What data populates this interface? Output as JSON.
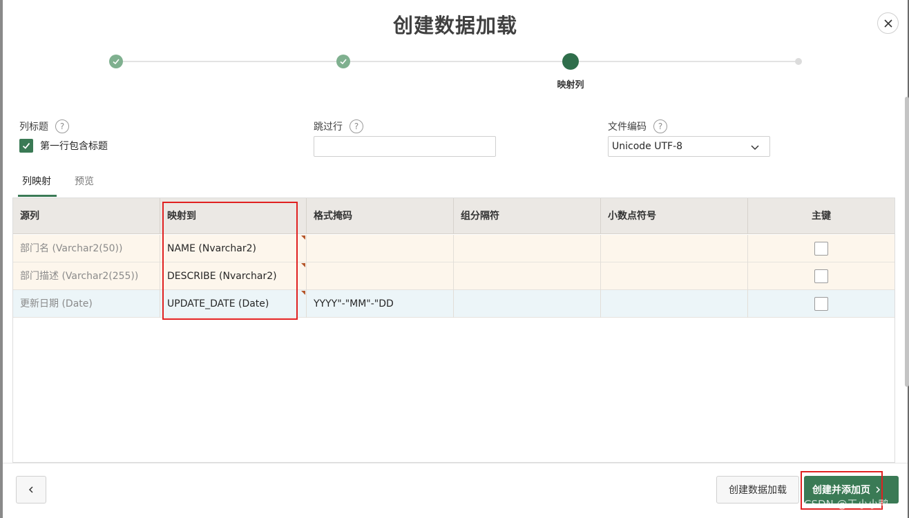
{
  "dialog": {
    "title": "创建数据加载",
    "close_icon": "close-icon"
  },
  "wizard": {
    "current_step_label": "映射列"
  },
  "settings": {
    "column_title_label": "列标题",
    "first_row_header_label": "第一行包含标题",
    "first_row_header_checked": true,
    "skip_rows_label": "跳过行",
    "skip_rows_value": "",
    "file_encoding_label": "文件编码",
    "file_encoding_value": "Unicode UTF-8"
  },
  "tabs": [
    "列映射",
    "预览"
  ],
  "grid": {
    "headers": [
      "源列",
      "映射到",
      "格式掩码",
      "组分隔符",
      "小数点符号",
      "主键"
    ],
    "rows": [
      {
        "source": "部门名 (Varchar2(50))",
        "mapped": "NAME (Nvarchar2)",
        "format": "",
        "group": "",
        "decimal": "",
        "pk": false
      },
      {
        "source": "部门描述 (Varchar2(255))",
        "mapped": "DESCRIBE (Nvarchar2)",
        "format": "",
        "group": "",
        "decimal": "",
        "pk": false
      },
      {
        "source": "更新日期 (Date)",
        "mapped": "UPDATE_DATE (Date)",
        "format": "YYYY\"-\"MM\"-\"DD",
        "group": "",
        "decimal": "",
        "pk": false
      }
    ],
    "row_colors": [
      "#fdf6ec",
      "#fdf6ec",
      "#ecf5f8"
    ]
  },
  "footer": {
    "secondary_label": "创建数据加载",
    "primary_label": "创建并添加页",
    "watermark": "CSDN @王小小鸭"
  },
  "colors": {
    "accent": "#3a7a55",
    "highlight": "#e02020"
  }
}
